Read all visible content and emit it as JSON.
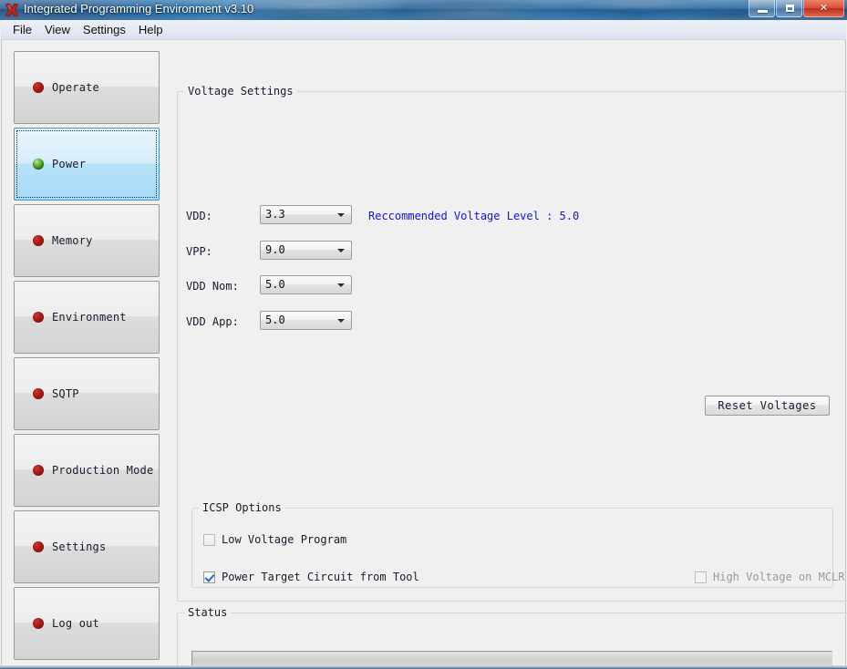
{
  "window": {
    "title": "Integrated Programming Environment v3.10",
    "app_icon": "red-butterfly-icon",
    "minimize_label": "",
    "maximize_label": "",
    "close_label": "✕"
  },
  "menubar": {
    "items": [
      {
        "label": "File"
      },
      {
        "label": "View"
      },
      {
        "label": "Settings"
      },
      {
        "label": "Help"
      }
    ]
  },
  "sidebar": {
    "items": [
      {
        "label": "Operate",
        "icon": "red-dot-icon",
        "selected": false
      },
      {
        "label": "Power",
        "icon": "green-sphere-icon",
        "selected": true
      },
      {
        "label": "Memory",
        "icon": "red-dot-icon",
        "selected": false
      },
      {
        "label": "Environment",
        "icon": "red-dot-icon",
        "selected": false
      },
      {
        "label": "SQTP",
        "icon": "red-dot-icon",
        "selected": false
      },
      {
        "label": "Production Mode",
        "icon": "red-dot-icon",
        "selected": false
      },
      {
        "label": "Settings",
        "icon": "red-dot-icon",
        "selected": false
      },
      {
        "label": "Log out",
        "icon": "red-dot-icon",
        "selected": false
      }
    ]
  },
  "voltage_settings": {
    "group_title": "Voltage Settings",
    "recommendation": "Reccommended Voltage Level : 5.0",
    "recommendation_color": "#1414e6",
    "fields": [
      {
        "label": "VDD:",
        "value": "3.3"
      },
      {
        "label": "VPP:",
        "value": "9.0"
      },
      {
        "label": "VDD Nom:",
        "value": "5.0"
      },
      {
        "label": "VDD App:",
        "value": "5.0"
      }
    ],
    "reset_button": "Reset Voltages"
  },
  "icsp_options": {
    "group_title": "ICSP Options",
    "low_voltage_program": {
      "label": "Low Voltage Program",
      "checked": false,
      "enabled": true
    },
    "power_target_circuit": {
      "label": "Power Target Circuit from Tool",
      "checked": true,
      "enabled": true
    },
    "high_voltage_mclr": {
      "label": "High Voltage on MCLR",
      "checked": false,
      "enabled": false
    }
  },
  "status": {
    "group_title": "Status",
    "message": ""
  }
}
